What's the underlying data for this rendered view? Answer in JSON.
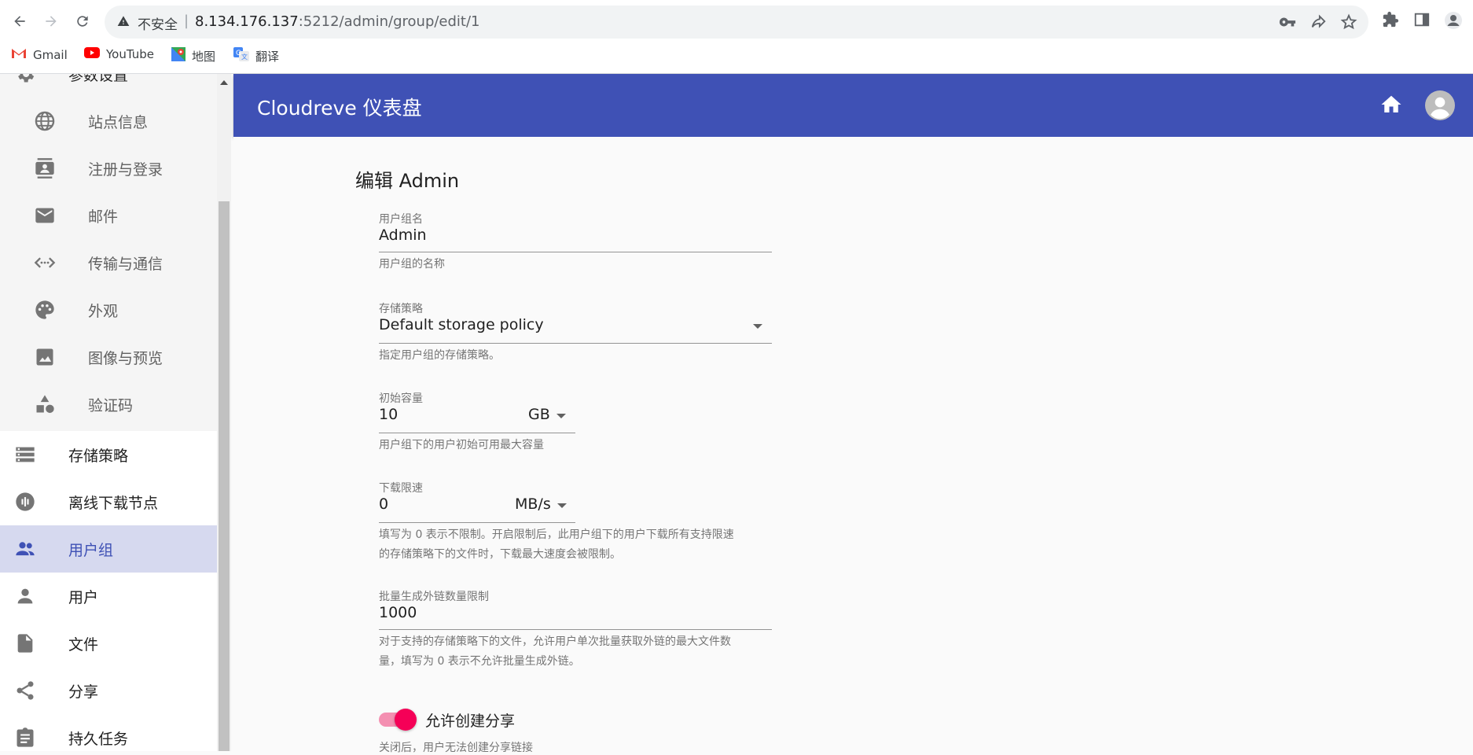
{
  "browser": {
    "insecure_label": "不安全",
    "url_host": "8.134.176.137",
    "url_rest": ":5212/admin/group/edit/1",
    "bookmarks": [
      {
        "label": "Gmail",
        "icon": "gmail-icon"
      },
      {
        "label": "YouTube",
        "icon": "youtube-icon"
      },
      {
        "label": "地图",
        "icon": "maps-icon"
      },
      {
        "label": "翻译",
        "icon": "translate-icon"
      }
    ]
  },
  "sidebar": {
    "items": [
      {
        "label": "参数设置",
        "icon": "gear-icon",
        "sub": false
      },
      {
        "label": "站点信息",
        "icon": "globe-icon",
        "sub": true
      },
      {
        "label": "注册与登录",
        "icon": "contacts-icon",
        "sub": true
      },
      {
        "label": "邮件",
        "icon": "mail-icon",
        "sub": true
      },
      {
        "label": "传输与通信",
        "icon": "code-arrows-icon",
        "sub": true
      },
      {
        "label": "外观",
        "icon": "palette-icon",
        "sub": true
      },
      {
        "label": "图像与预览",
        "icon": "image-icon",
        "sub": true
      },
      {
        "label": "验证码",
        "icon": "shapes-icon",
        "sub": true
      },
      {
        "label": "存储策略",
        "icon": "storage-icon",
        "sub": false
      },
      {
        "label": "离线下载节点",
        "icon": "download-node-icon",
        "sub": false
      },
      {
        "label": "用户组",
        "icon": "group-icon",
        "sub": false,
        "active": true
      },
      {
        "label": "用户",
        "icon": "person-icon",
        "sub": false
      },
      {
        "label": "文件",
        "icon": "file-icon",
        "sub": false
      },
      {
        "label": "分享",
        "icon": "share-icon",
        "sub": false
      },
      {
        "label": "持久任务",
        "icon": "assignment-icon",
        "sub": false
      }
    ]
  },
  "appbar": {
    "title": "Cloudreve 仪表盘"
  },
  "form": {
    "page_title": "编辑 Admin",
    "group_name": {
      "label": "用户组名",
      "value": "Admin",
      "help": "用户组的名称"
    },
    "storage_policy": {
      "label": "存储策略",
      "value": "Default storage policy",
      "help": "指定用户组的存储策略。"
    },
    "initial_capacity": {
      "label": "初始容量",
      "value": "10",
      "unit": "GB",
      "help": "用户组下的用户初始可用最大容量"
    },
    "download_limit": {
      "label": "下载限速",
      "value": "0",
      "unit": "MB/s",
      "help_line1": "填写为 0 表示不限制。开启限制后，此用户组下的用户下载所有支持限速",
      "help_line2": "的存储策略下的文件时，下载最大速度会被限制。"
    },
    "batch_link_limit": {
      "label": "批量生成外链数量限制",
      "value": "1000",
      "help_line1": "对于支持的存储策略下的文件，允许用户单次批量获取外链的最大文件数",
      "help_line2": "量，填写为 0 表示不允许批量生成外链。"
    },
    "allow_share": {
      "label": "允许创建分享",
      "checked": true,
      "help": "关闭后，用户无法创建分享链接"
    }
  }
}
